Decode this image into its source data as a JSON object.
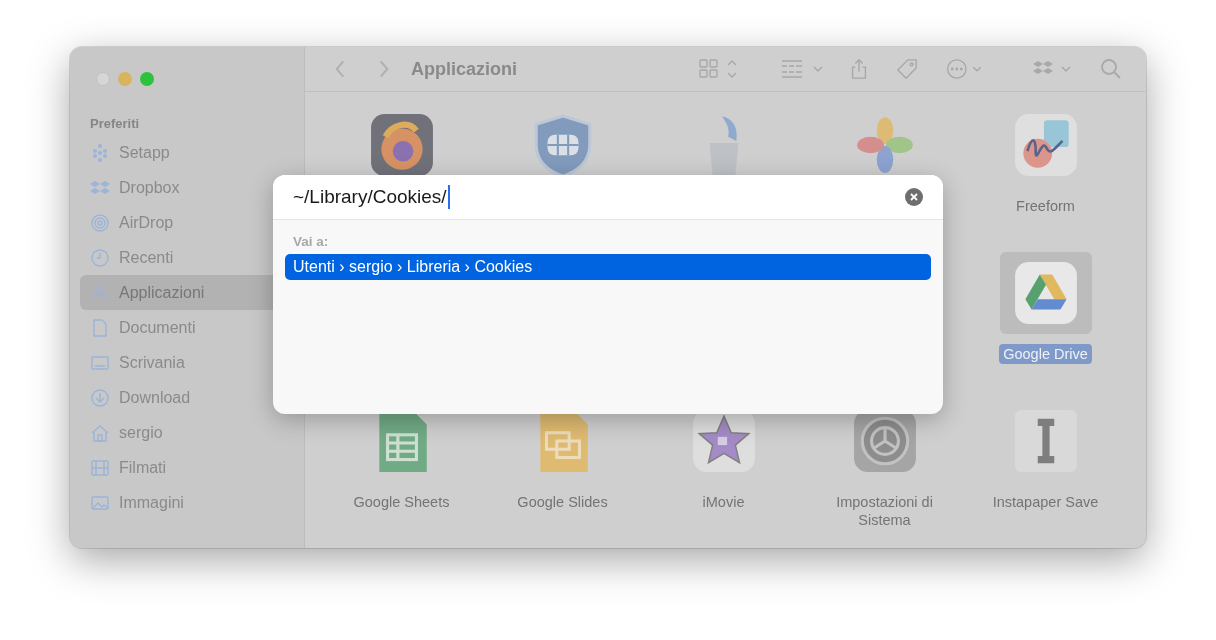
{
  "sidebar": {
    "heading": "Preferiti",
    "items": [
      {
        "label": "Setapp",
        "kind": "setapp",
        "selected": false
      },
      {
        "label": "Dropbox",
        "kind": "dropbox",
        "selected": false
      },
      {
        "label": "AirDrop",
        "kind": "airdrop",
        "selected": false
      },
      {
        "label": "Recenti",
        "kind": "clock",
        "selected": false
      },
      {
        "label": "Applicazioni",
        "kind": "apps",
        "selected": true
      },
      {
        "label": "Documenti",
        "kind": "document",
        "selected": false
      },
      {
        "label": "Scrivania",
        "kind": "desktop",
        "selected": false
      },
      {
        "label": "Download",
        "kind": "download",
        "selected": false
      },
      {
        "label": "sergio",
        "kind": "home",
        "selected": false
      },
      {
        "label": "Filmati",
        "kind": "film",
        "selected": false
      },
      {
        "label": "Immagini",
        "kind": "picture",
        "selected": false
      }
    ]
  },
  "toolbar": {
    "title": "Applicazioni"
  },
  "app_rows": [
    [
      {
        "kind": "firefox",
        "selected": false
      },
      {
        "kind": "shield",
        "selected": false
      },
      {
        "kind": "installer",
        "selected": false
      },
      {
        "kind": "photos",
        "selected": false
      },
      {
        "kind": "freeform",
        "label": "Freeform",
        "selected": false
      }
    ],
    [
      {
        "kind": "drive",
        "label": "Google Drive",
        "selected": true
      }
    ],
    [
      {
        "kind": "sheets",
        "label": "Google Sheets",
        "selected": false
      },
      {
        "kind": "slides",
        "label": "Google Slides",
        "selected": false
      },
      {
        "kind": "imovie",
        "label": "iMovie",
        "selected": false
      },
      {
        "kind": "settings",
        "label": "Impostazioni di Sistema",
        "selected": false
      },
      {
        "kind": "instapaper",
        "label": "Instapaper Save",
        "selected": false
      }
    ]
  ],
  "go_to_dialog": {
    "path": "~/Library/Cookies/",
    "section_label": "Vai a:",
    "results": [
      {
        "text": "Utenti › sergio › Libreria › Cookies",
        "selected": true
      }
    ]
  }
}
